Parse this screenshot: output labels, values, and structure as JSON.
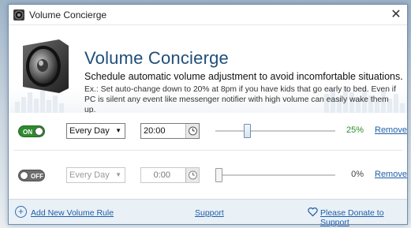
{
  "window": {
    "title": "Volume Concierge"
  },
  "header": {
    "app_name": "Volume Concierge",
    "subtitle": "Schedule automatic volume adjustment to avoid incomfortable situations.",
    "example": "Ex.: Set auto-change down to 20% at 8pm if you have kids that go early to bed. Even if PC is silent any event like messenger notifier with high volume can easily wake them up."
  },
  "rules": [
    {
      "enabled": true,
      "toggle_label": "ON",
      "schedule": "Every Day",
      "time": "20:00",
      "volume_percent": 25,
      "volume_label": "25%",
      "remove_label": "Remove"
    },
    {
      "enabled": false,
      "toggle_label": "OFF",
      "schedule": "Every Day",
      "time": "0:00",
      "volume_percent": 0,
      "volume_label": "0%",
      "remove_label": "Remove"
    }
  ],
  "footer": {
    "add_rule_label": "Add New Volume Rule",
    "support_label": "Support",
    "donate_label": "Please Donate to Support"
  },
  "colors": {
    "accent": "#1f4e79",
    "link": "#1f5fa8",
    "toggle_on": "#2f8a2f",
    "percent_on": "#2e8b2e"
  },
  "icons": {
    "app": "speaker-icon",
    "close": "close-icon",
    "clock": "clock-icon",
    "add": "plus-circle-icon",
    "donate": "heart-icon"
  }
}
